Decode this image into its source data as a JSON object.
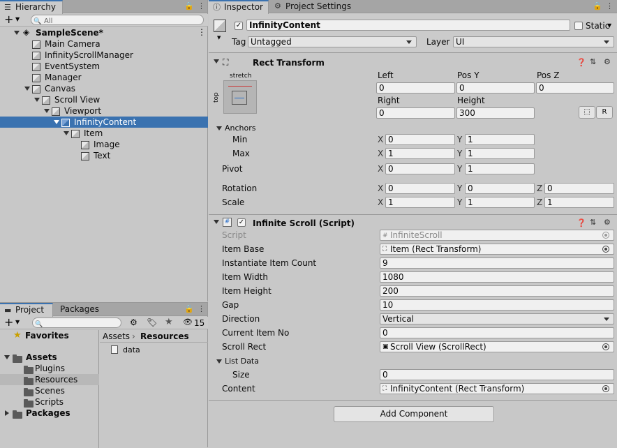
{
  "hierarchy": {
    "tab": "Hierarchy",
    "search_placeholder": "All",
    "scene": "SampleScene*",
    "items": [
      {
        "label": "Main Camera"
      },
      {
        "label": "InfinityScrollManager"
      },
      {
        "label": "EventSystem"
      },
      {
        "label": "Manager"
      },
      {
        "label": "Canvas"
      },
      {
        "label": "Scroll View"
      },
      {
        "label": "Viewport"
      },
      {
        "label": "InfinityContent"
      },
      {
        "label": "Item"
      },
      {
        "label": "Image"
      },
      {
        "label": "Text"
      }
    ]
  },
  "project": {
    "tabs": [
      "Project",
      "Packages"
    ],
    "hidden_count": "15",
    "tree": {
      "favorites": "Favorites",
      "assets": "Assets",
      "folders": [
        "Plugins",
        "Resources",
        "Scenes",
        "Scripts"
      ],
      "packages": "Packages"
    },
    "breadcrumb": [
      "Assets",
      "Resources"
    ],
    "files": [
      "data"
    ]
  },
  "inspector": {
    "tabs": [
      "Inspector",
      "Project Settings"
    ],
    "object_name": "InfinityContent",
    "static_label": "Static",
    "tag_label": "Tag",
    "tag_value": "Untagged",
    "layer_label": "Layer",
    "layer_value": "UI",
    "rect_transform": {
      "title": "Rect Transform",
      "anchor_h": "stretch",
      "anchor_v": "top",
      "left_label": "Left",
      "left": "0",
      "posy_label": "Pos Y",
      "posy": "0",
      "posz_label": "Pos Z",
      "posz": "0",
      "right_label": "Right",
      "right": "0",
      "height_label": "Height",
      "height": "300",
      "r_button": "R",
      "anchors_label": "Anchors",
      "min_label": "Min",
      "min_x": "0",
      "min_y": "1",
      "max_label": "Max",
      "max_x": "1",
      "max_y": "1",
      "pivot_label": "Pivot",
      "pivot_x": "0",
      "pivot_y": "1",
      "rotation_label": "Rotation",
      "rot_x": "0",
      "rot_y": "0",
      "rot_z": "0",
      "scale_label": "Scale",
      "scale_x": "1",
      "scale_y": "1",
      "scale_z": "1"
    },
    "script": {
      "title": "Infinite Scroll (Script)",
      "script_label": "Script",
      "script_value": "InfiniteScroll",
      "fields": [
        {
          "label": "Item Base",
          "value": "Item (Rect Transform)"
        },
        {
          "label": "Instantiate Item Count",
          "value": "9"
        },
        {
          "label": "Item Width",
          "value": "1080"
        },
        {
          "label": "Item Height",
          "value": "200"
        },
        {
          "label": "Gap",
          "value": "10"
        },
        {
          "label": "Direction",
          "value": "Vertical"
        },
        {
          "label": "Current Item No",
          "value": "0"
        },
        {
          "label": "Scroll Rect",
          "value": "Scroll View (ScrollRect)"
        }
      ],
      "list_data_label": "List Data",
      "size_label": "Size",
      "size_value": "0",
      "content_label": "Content",
      "content_value": "InfinityContent (Rect Transform)"
    },
    "add_component": "Add Component"
  }
}
